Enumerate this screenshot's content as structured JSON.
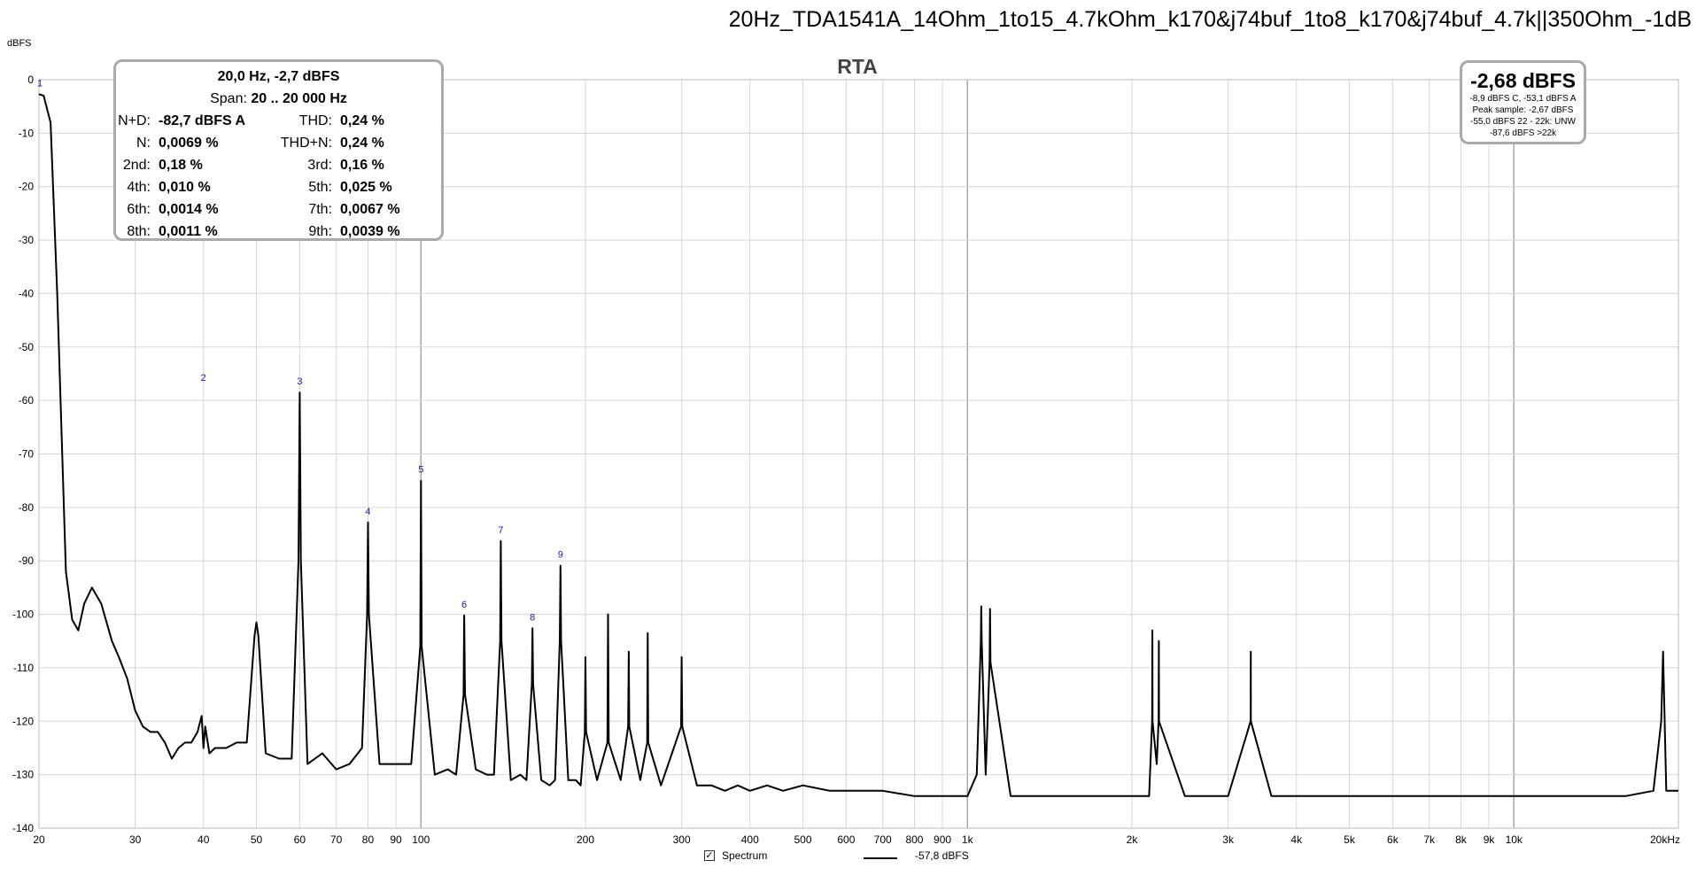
{
  "title": "20Hz_TDA1541A_14Ohm_1to15_4.7kOhm_k170&j74buf_1to8_k170&j74buf_4.7k||350Ohm_-1dB",
  "panel_label": "RTA",
  "info_box": {
    "header": "20,0 Hz, -2,7 dBFS",
    "span_label": "Span:",
    "span_value": "20 .. 20 000 Hz",
    "rows": [
      {
        "l1": "N+D:",
        "v1": "-82,7 dBFS A",
        "l2": "THD:",
        "v2": "0,24 %"
      },
      {
        "l1": "N:",
        "v1": "0,0069 %",
        "l2": "THD+N:",
        "v2": "0,24 %"
      },
      {
        "l1": "2nd:",
        "v1": "0,18 %",
        "l2": "3rd:",
        "v2": "0,16 %"
      },
      {
        "l1": "4th:",
        "v1": "0,010 %",
        "l2": "5th:",
        "v2": "0,025 %"
      },
      {
        "l1": "6th:",
        "v1": "0,0014 %",
        "l2": "7th:",
        "v2": "0,0067 %"
      },
      {
        "l1": "8th:",
        "v1": "0,0011 %",
        "l2": "9th:",
        "v2": "0,0039 %"
      }
    ]
  },
  "level_box": {
    "main": "-2,68 dBFS",
    "lines": [
      "-8,9 dBFS C, -53,1 dBFS A",
      "Peak sample: -2,67 dBFS",
      "-55,0 dBFS 22 - 22k: UNW",
      "-87,6 dBFS >22k"
    ]
  },
  "legend": {
    "checked": true,
    "label": "Spectrum",
    "value": "-57,8 dBFS"
  },
  "chart_data": {
    "type": "line",
    "xscale": "log",
    "yunit": "dBFS",
    "ylabel": "dBFS",
    "xlim": [
      20,
      20000
    ],
    "ylim": [
      -140,
      0
    ],
    "grid": true,
    "yticks": [
      0,
      -10,
      -20,
      -30,
      -40,
      -50,
      -60,
      -70,
      -80,
      -90,
      -100,
      -110,
      -120,
      -130,
      -140
    ],
    "ytick_labels": [
      "0",
      "-10",
      "-20",
      "-30",
      "-40",
      "-50",
      "-60",
      "-70",
      "-80",
      "-90",
      "-100",
      "-110",
      "-120",
      "-130",
      "-140"
    ],
    "xticks": [
      20,
      30,
      40,
      50,
      60,
      70,
      80,
      90,
      100,
      200,
      300,
      400,
      500,
      600,
      700,
      800,
      900,
      1000,
      2000,
      3000,
      4000,
      5000,
      6000,
      7000,
      8000,
      9000,
      10000,
      20000
    ],
    "xtick_labels": [
      "20",
      "30",
      "40",
      "50",
      "60",
      "70",
      "80",
      "90",
      "100",
      "200",
      "300",
      "400",
      "500",
      "600",
      "700",
      "800",
      "900",
      "1k",
      "2k",
      "3k",
      "4k",
      "5k",
      "6k",
      "7k",
      "8k",
      "9k",
      "10k",
      "20kHz"
    ],
    "harmonics": [
      {
        "n": "1",
        "freq": 20,
        "db": -2.7
      },
      {
        "n": "2",
        "freq": 40,
        "db": -57.8
      },
      {
        "n": "3",
        "freq": 60,
        "db": -58.5
      },
      {
        "n": "4",
        "freq": 80,
        "db": -82.8
      },
      {
        "n": "5",
        "freq": 100,
        "db": -75
      },
      {
        "n": "6",
        "freq": 120,
        "db": -100.2
      },
      {
        "n": "7",
        "freq": 140,
        "db": -86.3
      },
      {
        "n": "8",
        "freq": 160,
        "db": -102.6
      },
      {
        "n": "9",
        "freq": 180,
        "db": -90.9
      }
    ],
    "series": [
      {
        "x": [
          20,
          20.4,
          21,
          21.6,
          22.4,
          23,
          23.6,
          24.2,
          25,
          26,
          27.2,
          28,
          29,
          30,
          31,
          32,
          33,
          34,
          35,
          36,
          37,
          38,
          39,
          39.7,
          40,
          40.3,
          41,
          42,
          44,
          46,
          48,
          49.6,
          50,
          50.4,
          52,
          55,
          58,
          59.7,
          60,
          60.3,
          62,
          66,
          70,
          74,
          78,
          79.7,
          80,
          80.3,
          84,
          90,
          96,
          99.7,
          100,
          100.3,
          106,
          112,
          116,
          119.7,
          120,
          120.4,
          126,
          132,
          136,
          139.6,
          140,
          140.4,
          146,
          152,
          156,
          159.6,
          160,
          160.4,
          166,
          172,
          176,
          179.5,
          180,
          180.5,
          186,
          192,
          196,
          199.5,
          200,
          200.5,
          210,
          219.4,
          220,
          220.6,
          232,
          239.4,
          240,
          240.6,
          252,
          259.4,
          260,
          260.6,
          275,
          299.3,
          300,
          300.7,
          320,
          340,
          360,
          380,
          400,
          430,
          460,
          500,
          560,
          620,
          700,
          800,
          900,
          1000,
          1040,
          1058,
          1060,
          1062,
          1080,
          1098,
          1100,
          1102,
          1200,
          1400,
          1600,
          1800,
          2000,
          2150,
          2178,
          2180,
          2182,
          2220,
          2238,
          2240,
          2242,
          2500,
          2800,
          3000,
          3298,
          3300,
          3302,
          3600,
          4000,
          4500,
          5000,
          6000,
          7000,
          8000,
          9000,
          10000,
          12000,
          14000,
          16000,
          18000,
          18600,
          18750,
          19000,
          19500,
          20000
        ],
        "y": [
          -2.7,
          -3,
          -8,
          -40,
          -92,
          -101,
          -103,
          -98,
          -95,
          -98,
          -105,
          -108,
          -112,
          -118,
          -121,
          -122,
          -122,
          -124,
          -127,
          -125,
          -124,
          -124,
          -122,
          -119,
          -125,
          -121,
          -126,
          -125,
          -125,
          -124,
          -124,
          -104,
          -101.5,
          -104,
          -126,
          -127,
          -127,
          -90,
          -58.5,
          -90,
          -128,
          -126,
          -129,
          -128,
          -125,
          -100,
          -82.8,
          -100,
          -128,
          -128,
          -128,
          -106,
          -75,
          -106,
          -130,
          -129,
          -130,
          -115,
          -100.2,
          -115,
          -129,
          -130,
          -130,
          -105,
          -86.3,
          -105,
          -131,
          -130,
          -131,
          -113,
          -102.6,
          -113,
          -131,
          -132,
          -131,
          -105,
          -90.9,
          -105,
          -131,
          -131,
          -132,
          -122,
          -108,
          -122,
          -131,
          -124,
          -100,
          -124,
          -131,
          -121,
          -107,
          -121,
          -131,
          -124,
          -103.5,
          -124,
          -132,
          -121,
          -108,
          -121,
          -132,
          -132,
          -133,
          -132,
          -133,
          -132,
          -133,
          -132,
          -133,
          -133,
          -133,
          -134,
          -134,
          -134,
          -130,
          -105,
          -98.5,
          -105,
          -130,
          -109,
          -99,
          -109,
          -134,
          -134,
          -134,
          -134,
          -134,
          -134,
          -120,
          -103,
          -120,
          -128,
          -120,
          -105,
          -120,
          -134,
          -134,
          -134,
          -120,
          -107,
          -120,
          -134,
          -134,
          -134,
          -134,
          -134,
          -134,
          -134,
          -134,
          -134,
          -134,
          -134,
          -134,
          -133,
          -120,
          -107,
          -133,
          -133,
          -133
        ]
      }
    ]
  }
}
